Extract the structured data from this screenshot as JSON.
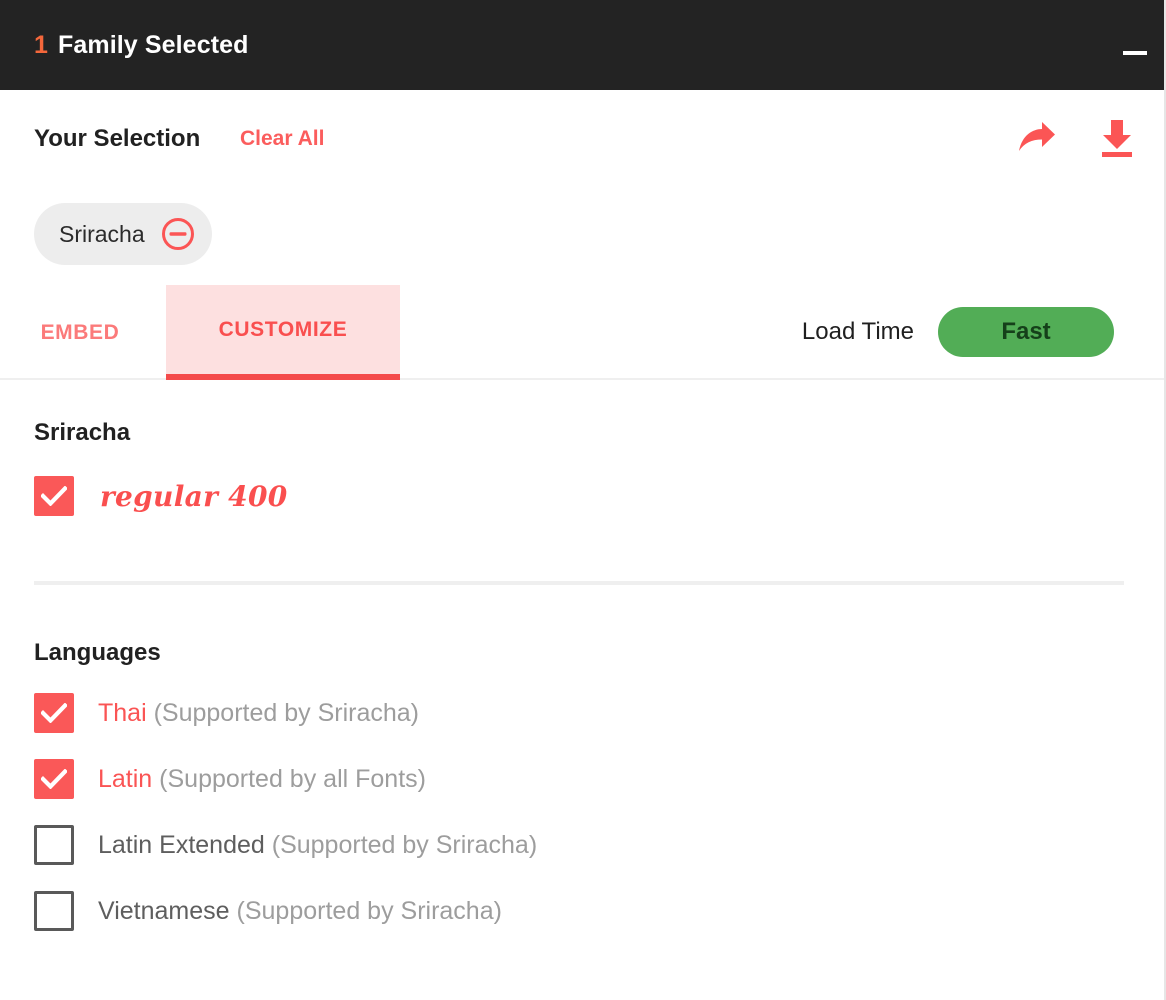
{
  "header": {
    "count": "1",
    "title": "Family Selected",
    "minimize_icon": "minimize-icon",
    "bg_color": "#232323",
    "count_color": "#f4673b"
  },
  "selection": {
    "title": "Your Selection",
    "clear_all_label": "Clear All",
    "share_icon": "share-arrow-icon",
    "download_icon": "download-icon",
    "accent_color": "#fb5d5d",
    "chips": [
      {
        "label": "Sriracha",
        "remove_icon": "circle-minus-icon"
      }
    ]
  },
  "tabs": {
    "items": [
      {
        "id": "embed",
        "label": "EMBED",
        "active": false
      },
      {
        "id": "customize",
        "label": "CUSTOMIZE",
        "active": true
      }
    ],
    "active_color": "#f94f4f",
    "active_bg": "#fde0e0"
  },
  "load_time": {
    "label": "Load Time",
    "value": "Fast",
    "badge_color": "#52ad56",
    "badge_text_color": "#15401a"
  },
  "styles_section": {
    "heading": "Sriracha",
    "items": [
      {
        "label": "regular 400",
        "checked": true
      }
    ]
  },
  "languages_section": {
    "heading": "Languages",
    "items": [
      {
        "name": "Thai",
        "support": "(Supported by Sriracha)",
        "checked": true
      },
      {
        "name": "Latin",
        "support": "(Supported by all Fonts)",
        "checked": true
      },
      {
        "name": "Latin Extended",
        "support": "(Supported by Sriracha)",
        "checked": false
      },
      {
        "name": "Vietnamese",
        "support": "(Supported by Sriracha)",
        "checked": false
      }
    ]
  }
}
